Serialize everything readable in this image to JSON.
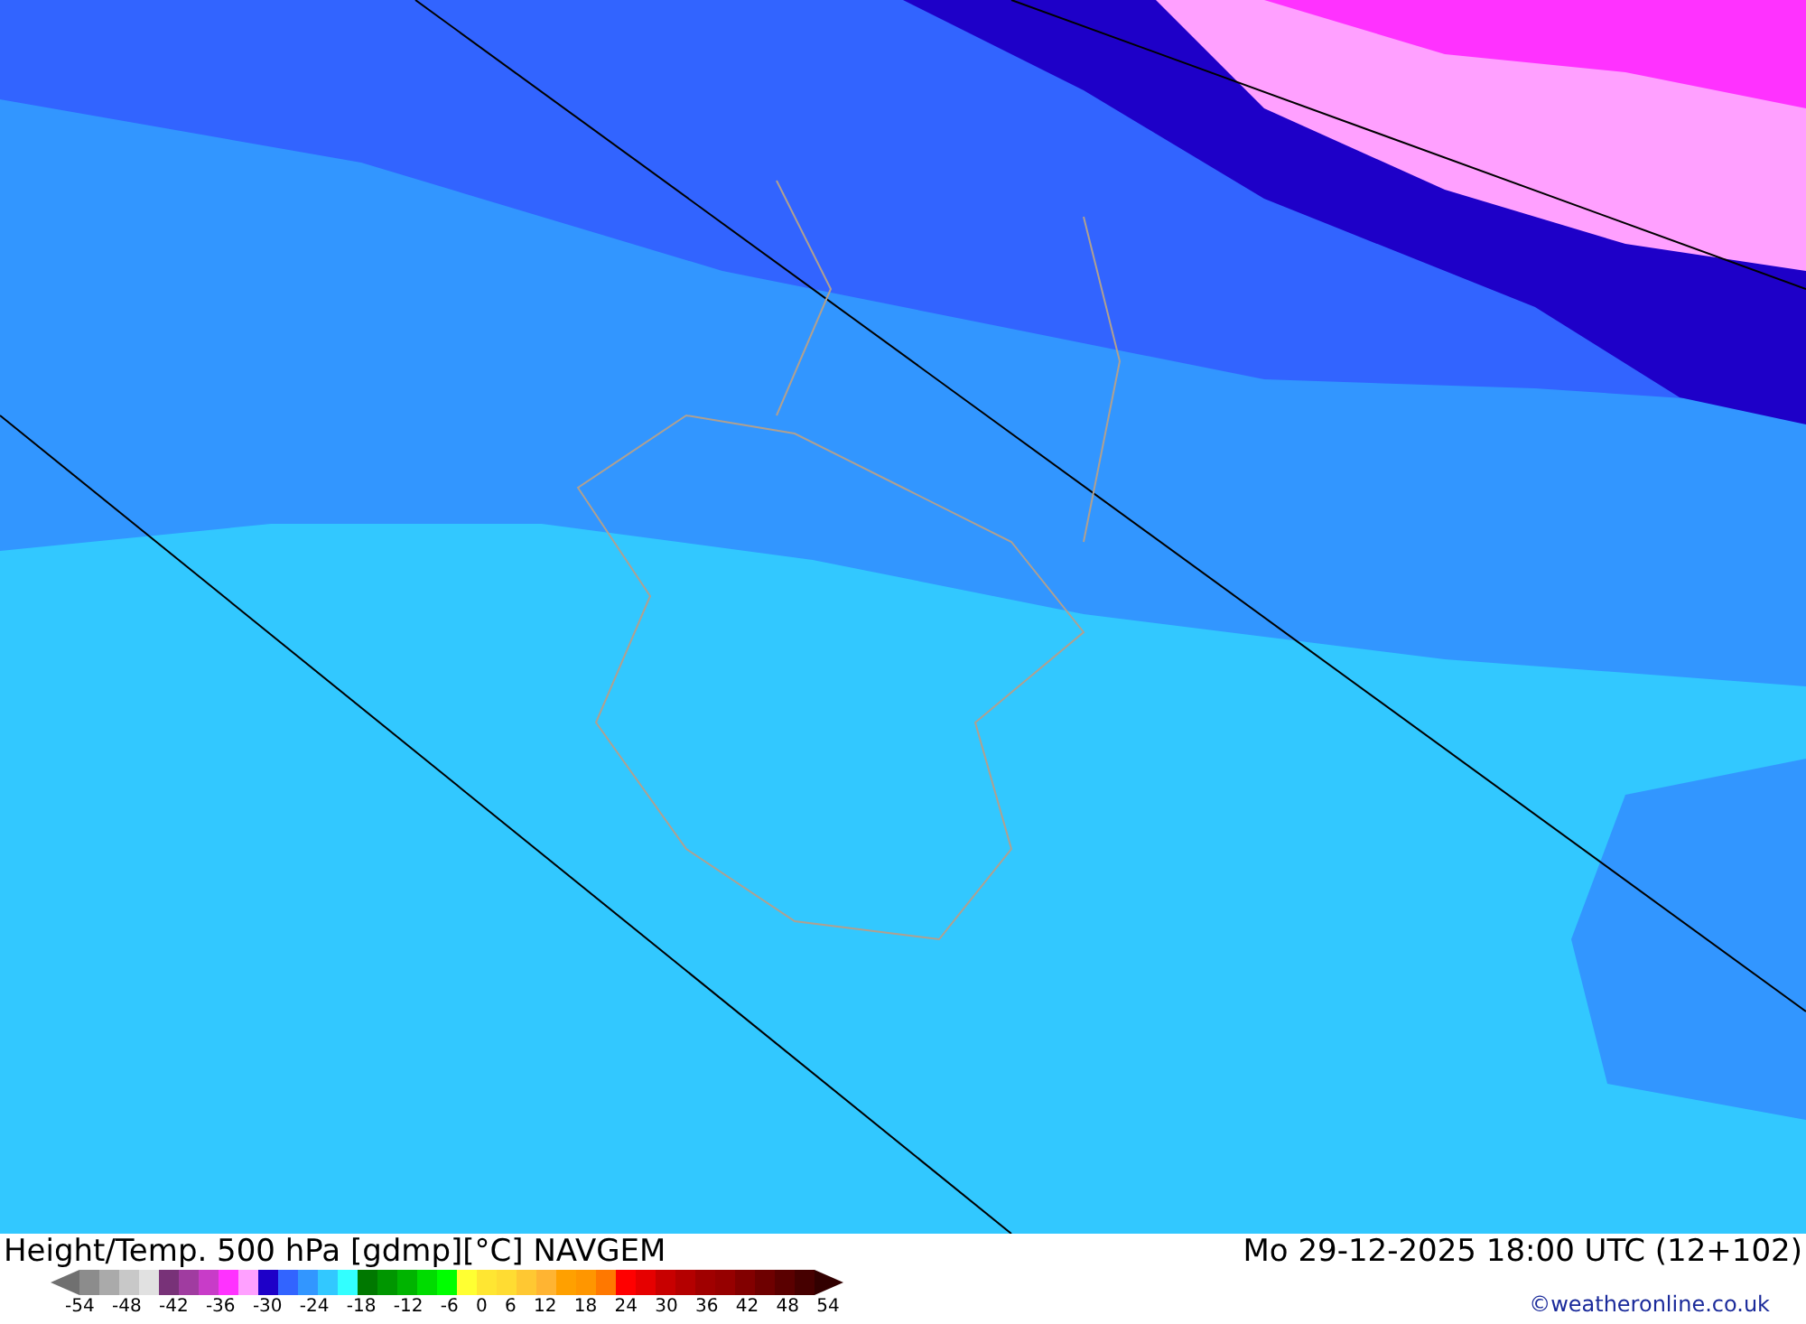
{
  "title": "Height/Temp. 500 hPa [gdmp][°C] NAVGEM",
  "valid_time": "Mo 29-12-2025 18:00 UTC (12+102)",
  "legend": {
    "swatches": [
      {
        "color": "#8c8c8c"
      },
      {
        "color": "#aaaaaa"
      },
      {
        "color": "#c8c8c8"
      },
      {
        "color": "#e1e1e1"
      },
      {
        "color": "#783278"
      },
      {
        "color": "#a03ca0"
      },
      {
        "color": "#c83cc8"
      },
      {
        "color": "#ff32ff"
      },
      {
        "color": "#ffa0ff"
      },
      {
        "color": "#1e00c8"
      },
      {
        "color": "#3264ff"
      },
      {
        "color": "#3296ff"
      },
      {
        "color": "#32c8ff"
      },
      {
        "color": "#32ffff"
      },
      {
        "color": "#007800"
      },
      {
        "color": "#009600"
      },
      {
        "color": "#00b400"
      },
      {
        "color": "#00dc00"
      },
      {
        "color": "#00ff00"
      },
      {
        "color": "#ffff32"
      },
      {
        "color": "#ffe632"
      },
      {
        "color": "#ffdc32"
      },
      {
        "color": "#ffc832"
      },
      {
        "color": "#ffb432"
      },
      {
        "color": "#ffa000"
      },
      {
        "color": "#ff9600"
      },
      {
        "color": "#ff7800"
      },
      {
        "color": "#ff0000"
      },
      {
        "color": "#e60000"
      },
      {
        "color": "#c80000"
      },
      {
        "color": "#b40000"
      },
      {
        "color": "#a00000"
      },
      {
        "color": "#960000"
      },
      {
        "color": "#820000"
      },
      {
        "color": "#6e0000"
      },
      {
        "color": "#5a0000"
      },
      {
        "color": "#460000"
      }
    ],
    "labels": [
      "-54",
      "-48",
      "-42",
      "-36",
      "-30",
      "-24",
      "-18",
      "-12",
      "-6",
      "0",
      "6",
      "12",
      "18",
      "24",
      "30",
      "36",
      "42",
      "48",
      "54"
    ]
  },
  "credit": "©weatheronline.co.uk"
}
